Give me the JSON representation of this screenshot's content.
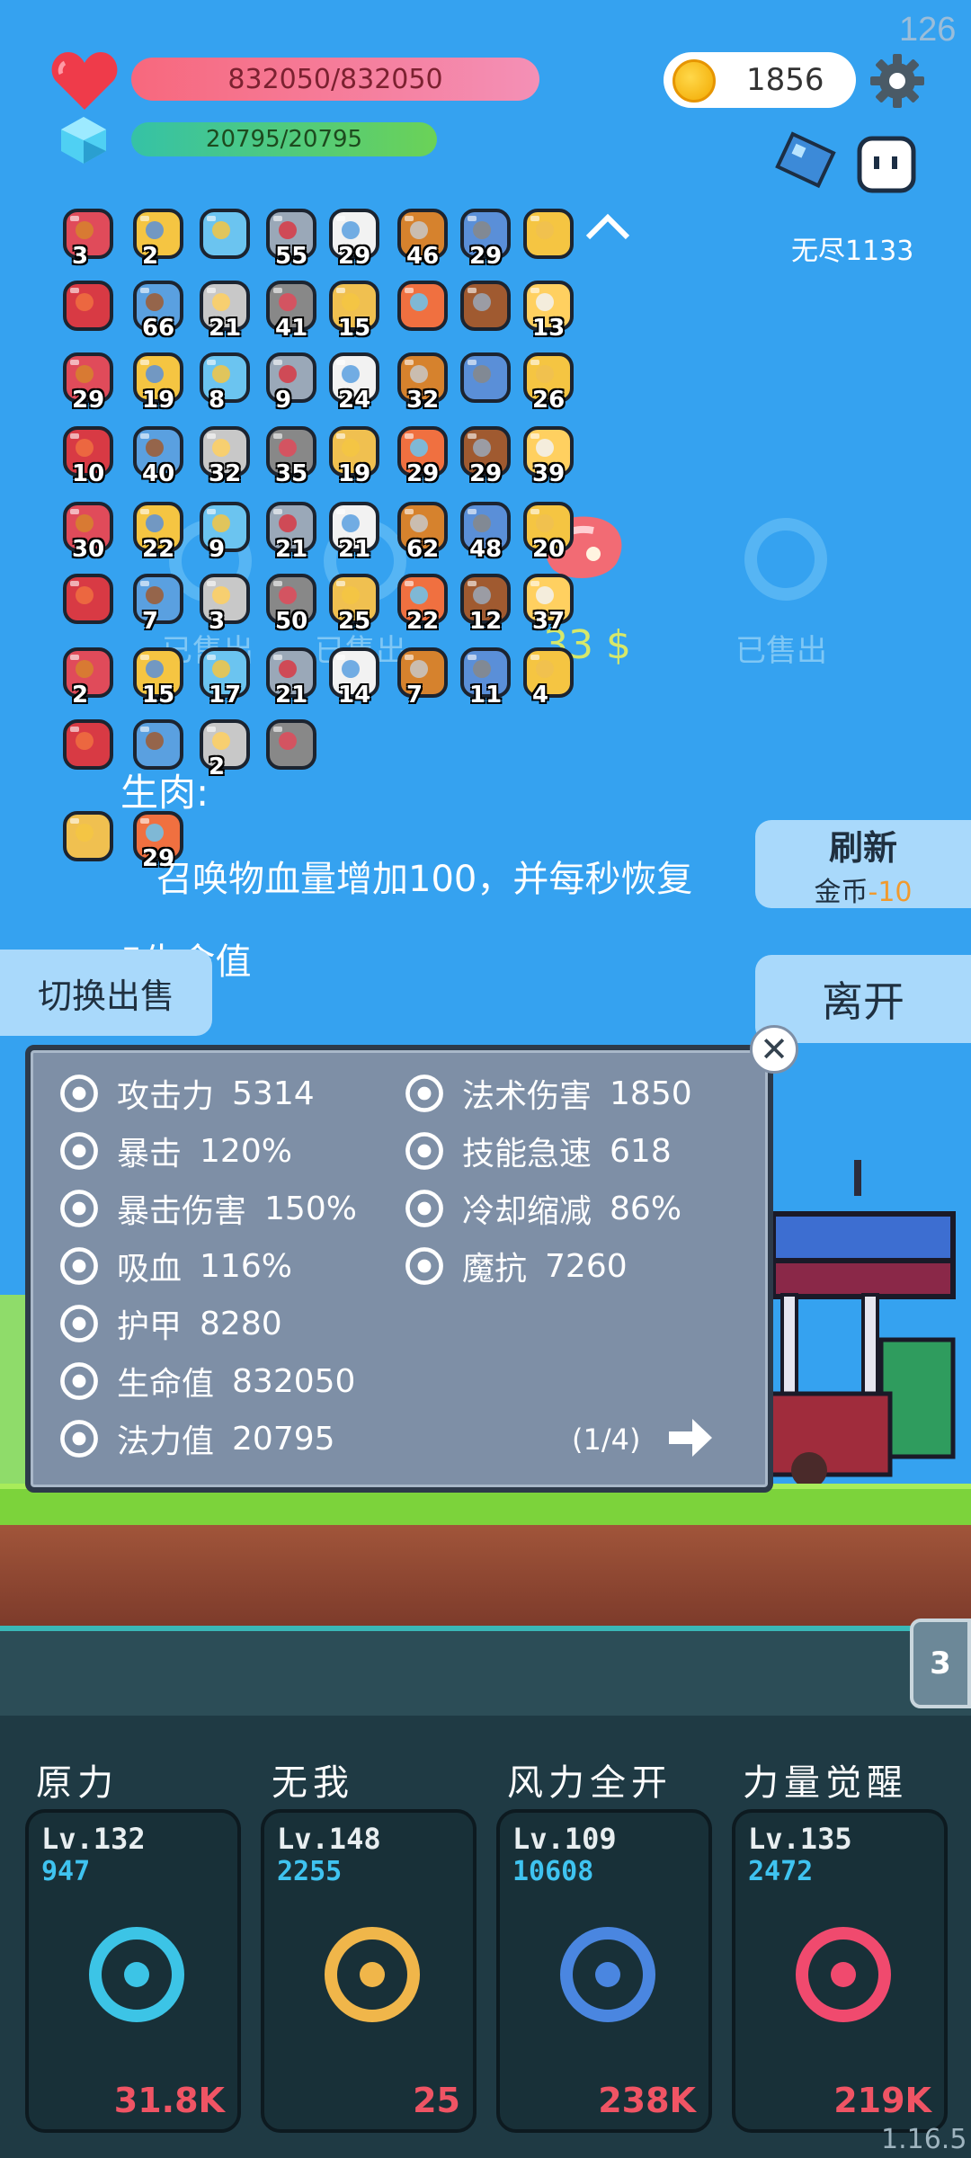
{
  "fps": "126",
  "player": {
    "hp": "832050/832050",
    "mana": "20795/20795",
    "coins": "1856",
    "endless": "无尽1133"
  },
  "items": {
    "row1": [
      {
        "name": "cash-heart-icon",
        "count": "3"
      },
      {
        "name": "question-hook-icon",
        "count": "2"
      },
      {
        "name": "magnifier-icon",
        "count": ""
      },
      {
        "name": "sword-icon",
        "count": "55"
      },
      {
        "name": "dice-icon",
        "count": "29"
      },
      {
        "name": "book-icon",
        "count": "46"
      },
      {
        "name": "shield-icon",
        "count": "29"
      },
      {
        "name": "crown-icon",
        "count": ""
      }
    ],
    "row2": [
      {
        "name": "magnet-icon",
        "count": ""
      },
      {
        "name": "star-card-icon",
        "count": "66"
      },
      {
        "name": "compass-icon",
        "count": "21"
      },
      {
        "name": "spiked-ball-icon",
        "count": "41"
      },
      {
        "name": "ring-icon",
        "count": "15"
      },
      {
        "name": "torch-icon",
        "count": ""
      },
      {
        "name": "treasure-chest-icon",
        "count": ""
      },
      {
        "name": "magic-wand-icon",
        "count": "13"
      }
    ],
    "row3": [
      {
        "name": "meteor-icon",
        "count": "29"
      },
      {
        "name": "crossbow-icon",
        "count": "19"
      },
      {
        "name": "axe-icon",
        "count": "8"
      },
      {
        "name": "grenade-icon",
        "count": "9"
      },
      {
        "name": "scroll-icon",
        "count": "24"
      },
      {
        "name": "cards-icon",
        "count": "32"
      },
      {
        "name": "treasure-map-icon",
        "count": ""
      },
      {
        "name": "ice-cream-icon",
        "count": "26"
      }
    ],
    "row4": [
      {
        "name": "target-icon",
        "count": "10"
      },
      {
        "name": "coconut-icon",
        "count": "40"
      },
      {
        "name": "cloud-icon",
        "count": "32"
      },
      {
        "name": "thermometer-icon",
        "count": "35"
      },
      {
        "name": "ghost-icon",
        "count": "19"
      },
      {
        "name": "cauldron-icon",
        "count": "29"
      },
      {
        "name": "gift-icon",
        "count": "29"
      },
      {
        "name": "potion-flask-icon",
        "count": "39"
      }
    ],
    "row5": [
      {
        "name": "bunny-icon",
        "count": "30"
      },
      {
        "name": "green-spirit-icon",
        "count": "22"
      },
      {
        "name": "spray-bottle-icon",
        "count": "9"
      },
      {
        "name": "envelope-icon",
        "count": "21"
      },
      {
        "name": "chat-bubble-icon",
        "count": "21"
      },
      {
        "name": "donut-icon",
        "count": "62"
      },
      {
        "name": "watermelon-icon",
        "count": "48"
      },
      {
        "name": "purple-orb-icon",
        "count": "20"
      }
    ],
    "row6": [
      {
        "name": "disc-icon",
        "count": ""
      },
      {
        "name": "cake-icon",
        "count": "7"
      },
      {
        "name": "door-icon",
        "count": "3"
      },
      {
        "name": "egg-flower-icon",
        "count": "50"
      },
      {
        "name": "jam-jar-icon",
        "count": "25"
      },
      {
        "name": "sock-icon",
        "count": "22"
      },
      {
        "name": "star-box-icon",
        "count": "12"
      },
      {
        "name": "apple-icon",
        "count": "37"
      }
    ],
    "row7": [
      {
        "name": "purple-shield-icon",
        "count": "2"
      },
      {
        "name": "mushroom-icon",
        "count": "15"
      },
      {
        "name": "strawberry-icon",
        "count": "17"
      },
      {
        "name": "bat-icon",
        "count": "21"
      },
      {
        "name": "fried-egg-icon",
        "count": "14"
      },
      {
        "name": "sunflower-icon",
        "count": "7"
      },
      {
        "name": "heart-icon",
        "count": "11"
      },
      {
        "name": "hand-icon",
        "count": "4"
      }
    ],
    "row8": [
      {
        "name": "pill-icon",
        "count": ""
      },
      {
        "name": "lime-icon",
        "count": ""
      },
      {
        "name": "blue-gem-icon",
        "count": "2"
      },
      {
        "name": "clipboard-icon",
        "count": ""
      }
    ],
    "row9": [
      {
        "name": "lightbulb-card-icon",
        "count": ""
      },
      {
        "name": "rock-card-icon",
        "count": "29"
      }
    ]
  },
  "shop": {
    "sold_label": "已售出",
    "price_label": "33 $"
  },
  "description": {
    "title": "生肉:",
    "line1": "召唤物血量增加100，并每秒恢复",
    "line2": "5生命值"
  },
  "buttons": {
    "refresh_title": "刷新",
    "refresh_cost_prefix": "金币",
    "refresh_cost": "-10",
    "switch_sell": "切换出售",
    "leave": "离开"
  },
  "stats": {
    "left": [
      {
        "label": "攻击力",
        "value": "5314"
      },
      {
        "label": "暴击",
        "value": "120%"
      },
      {
        "label": "暴击伤害",
        "value": "150%"
      },
      {
        "label": "吸血",
        "value": "116%"
      },
      {
        "label": "护甲",
        "value": "8280"
      },
      {
        "label": "生命值",
        "value": "832050"
      },
      {
        "label": "法力值",
        "value": "20795"
      }
    ],
    "right": [
      {
        "label": "法术伤害",
        "value": "1850"
      },
      {
        "label": "技能急速",
        "value": "618"
      },
      {
        "label": "冷却缩减",
        "value": "86%"
      },
      {
        "label": "魔抗",
        "value": "7260"
      }
    ],
    "page": "(1/4)"
  },
  "side_tab": "3",
  "skills": [
    {
      "name": "原力",
      "level": "Lv.132",
      "value": "947",
      "cost": "31.8K",
      "icon": "cycle-arrows-icon"
    },
    {
      "name": "无我",
      "level": "Lv.148",
      "value": "2255",
      "cost": "25",
      "icon": "eye-hand-icon"
    },
    {
      "name": "风力全开",
      "level": "Lv.109",
      "value": "10608",
      "cost": "238K",
      "icon": "feather-icon"
    },
    {
      "name": "力量觉醒",
      "level": "Lv.135",
      "value": "2472",
      "cost": "219K",
      "icon": "test-tube-icon"
    }
  ],
  "version": "1.16.5"
}
